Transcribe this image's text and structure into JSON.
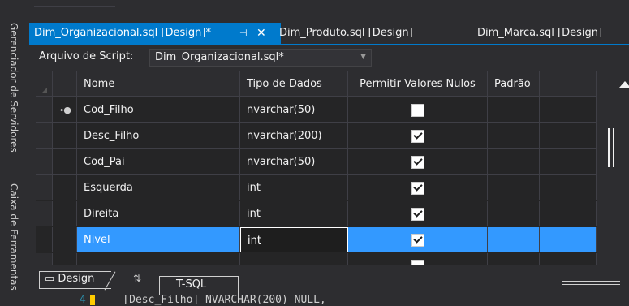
{
  "side_panels": [
    "Gerenciador de Servidores",
    "Caixa de Ferramentas"
  ],
  "tabs": [
    {
      "label": "Dim_Organizacional.sql [Design]*",
      "active": true
    },
    {
      "label": "Dim_Produto.sql [Design]",
      "active": false
    },
    {
      "label": "Dim_Marca.sql [Design]",
      "active": false
    }
  ],
  "tab_pin": "⊣",
  "tab_close": "✕",
  "script_bar": {
    "label": "Arquivo de Script:",
    "value": "Dim_Organizacional.sql*"
  },
  "grid": {
    "headers": [
      "Nome",
      "Tipo de Dados",
      "Permitir Valores Nulos",
      "Padrão"
    ],
    "rows": [
      {
        "name": "Cod_Filho",
        "type": "nvarchar(50)",
        "nullable": false,
        "key": true
      },
      {
        "name": "Desc_Filho",
        "type": "nvarchar(200)",
        "nullable": true,
        "key": false
      },
      {
        "name": "Cod_Pai",
        "type": "nvarchar(50)",
        "nullable": true,
        "key": false
      },
      {
        "name": "Esquerda",
        "type": "int",
        "nullable": true,
        "key": false
      },
      {
        "name": "Direita",
        "type": "int",
        "nullable": true,
        "key": false
      },
      {
        "name": "Nivel",
        "type": "int",
        "nullable": true,
        "key": false,
        "selected": true
      }
    ]
  },
  "bottom": {
    "design_tab": "Design",
    "swap_icon": "⇅",
    "tsql_tab": "T-SQL",
    "code_line_no": "4",
    "code": "    [Desc_Filho] NVARCHAR(200) NULL,"
  },
  "colors": {
    "accent": "#007acc",
    "selection": "#3399ff",
    "background": "#252526"
  }
}
